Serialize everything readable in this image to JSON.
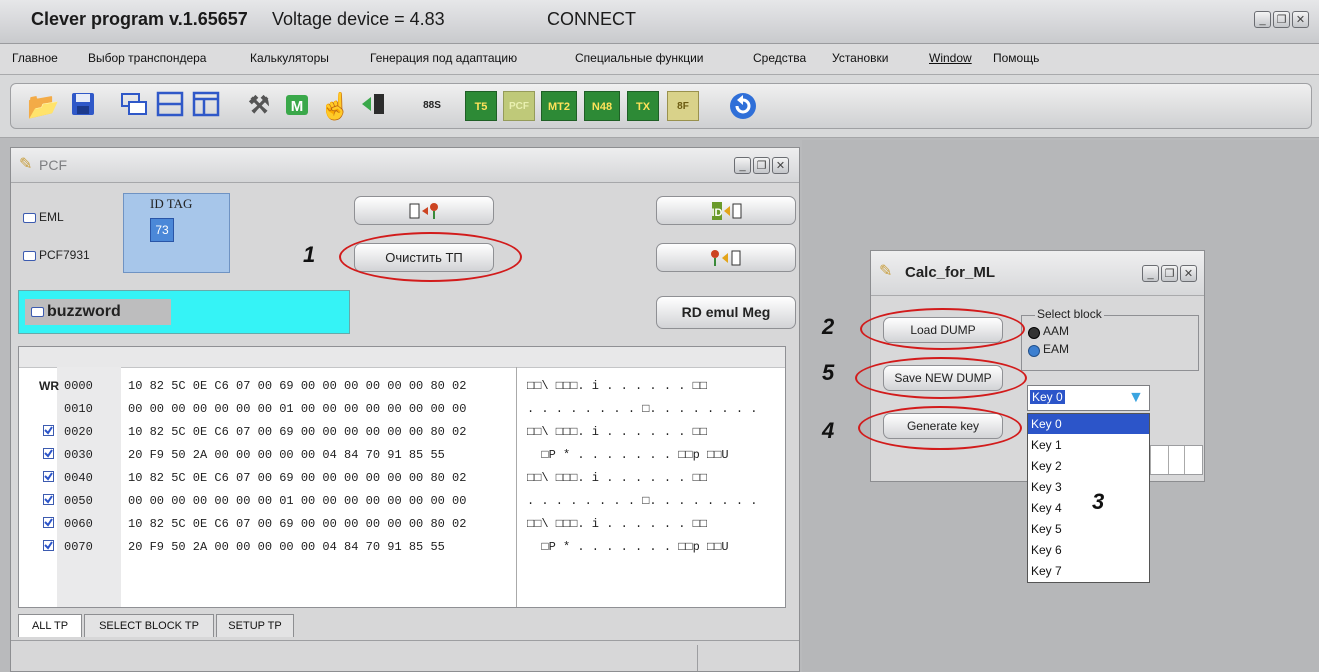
{
  "app": {
    "title": "Clever program v.1.65657",
    "voltage": "Voltage device = 4.83",
    "status": "CONNECT"
  },
  "menu": [
    "Главное",
    "Выбор транспондера",
    "Калькуляторы",
    "Генерация под адаптацию",
    "Специальные функции",
    "Средства",
    "Установки",
    "Window",
    "Помощь"
  ],
  "toolbar": {
    "t5": "T5",
    "pcf": "PCF",
    "mt2": "MT2",
    "n48": "N48",
    "tx": "TX",
    "bf": "8F",
    "bits": "88S"
  },
  "pcf_window": {
    "title": "PCF",
    "eml": "EML",
    "pcf7931": "PCF7931",
    "id_tag_label": "ID TAG",
    "id_tag_value": "73",
    "clear_button": "Очистить ТП",
    "buzzword": "buzzword",
    "rd_emul": "RD emul Meg",
    "wr": "WR",
    "rows": [
      {
        "addr": "0000",
        "bytes": "10 82 5C 0E C6 07 00 69 00 00 00 00 00 00 80 02",
        "ascii": "□□\\ □□□. i . . . . . . □□",
        "checked": false
      },
      {
        "addr": "0010",
        "bytes": "00 00 00 00 00 00 00 01 00 00 00 00 00 00 00 00",
        "ascii": ". . . . . . . . □. . . . . . . .",
        "checked": false
      },
      {
        "addr": "0020",
        "bytes": "10 82 5C 0E C6 07 00 69 00 00 00 00 00 00 80 02",
        "ascii": "□□\\ □□□. i . . . . . . □□",
        "checked": true
      },
      {
        "addr": "0030",
        "bytes": "20 F9 50 2A 00 00 00 00 00 04 84 70 91 85 55",
        "ascii": "  □P * . . . . . . . □□p □□U",
        "checked": true
      },
      {
        "addr": "0040",
        "bytes": "10 82 5C 0E C6 07 00 69 00 00 00 00 00 00 80 02",
        "ascii": "□□\\ □□□. i . . . . . . □□",
        "checked": true
      },
      {
        "addr": "0050",
        "bytes": "00 00 00 00 00 00 00 01 00 00 00 00 00 00 00 00",
        "ascii": ". . . . . . . . □. . . . . . . .",
        "checked": true
      },
      {
        "addr": "0060",
        "bytes": "10 82 5C 0E C6 07 00 69 00 00 00 00 00 00 80 02",
        "ascii": "□□\\ □□□. i . . . . . . □□",
        "checked": true
      },
      {
        "addr": "0070",
        "bytes": "20 F9 50 2A 00 00 00 00 00 04 84 70 91 85 55",
        "ascii": "  □P * . . . . . . . □□p □□U",
        "checked": true
      }
    ],
    "tabs": [
      "ALL TP",
      "SELECT BLOCK TP",
      "SETUP TP"
    ]
  },
  "calc_window": {
    "title": "Calc_for_ML",
    "load_dump": "Load DUMP",
    "save_new_dump": "Save NEW DUMP",
    "generate_key": "Generate key",
    "select_block": "Select block",
    "aam": "AAM",
    "eam": "EAM",
    "selected_key": "Key 0",
    "keys": [
      "Key 0",
      "Key 1",
      "Key 2",
      "Key 3",
      "Key 4",
      "Key 5",
      "Key 6",
      "Key 7"
    ]
  },
  "annotations": [
    "1",
    "2",
    "3",
    "4",
    "5"
  ],
  "colors": {
    "accent_cyan": "#35f3f6",
    "selection": "#2c55c9",
    "oval": "#d21b1b"
  }
}
